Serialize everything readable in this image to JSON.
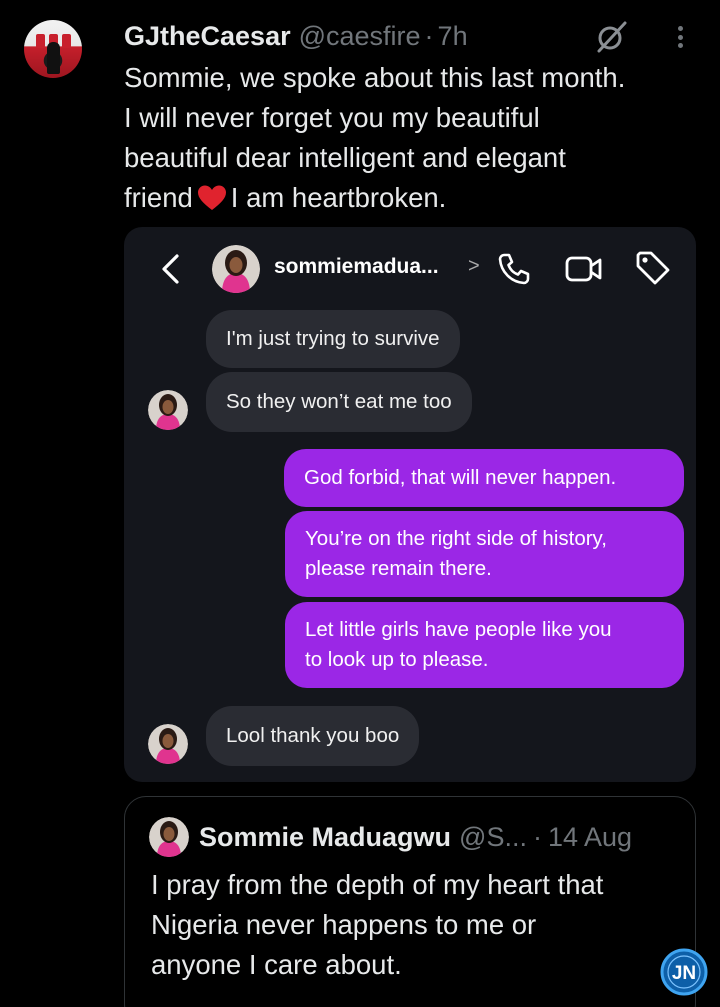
{
  "tweet": {
    "name": "GJtheCaesar",
    "handle": "@caesfire",
    "separator": "·",
    "time": "7h",
    "text_lines": [
      "Sommie, we spoke about this last month.",
      "I will never forget you my beautiful",
      "beautiful dear intelligent and  elegant",
      "friend",
      "I am heartbroken."
    ],
    "emoji": "red-heart"
  },
  "dm_screenshot": {
    "contact_name": "sommiemadua...",
    "chevron": ">",
    "messages": [
      {
        "side": "in",
        "text": "I'm just trying to survive"
      },
      {
        "side": "in",
        "text": "So they won’t eat me too"
      },
      {
        "side": "out",
        "text": "God forbid, that will never happen."
      },
      {
        "side": "out",
        "lines": [
          "You’re on the right side of history,",
          "please remain there."
        ]
      },
      {
        "side": "out",
        "lines": [
          "Let little girls have people like you",
          "to look up to please."
        ]
      },
      {
        "side": "in",
        "text": "Lool thank you boo"
      }
    ],
    "colors": {
      "outgoing": "#9b27e6",
      "incoming": "#2a2c33",
      "background": "#14161c"
    }
  },
  "quote": {
    "name": "Sommie Maduagwu",
    "handle": "@S...",
    "separator": "·",
    "time": "14 Aug",
    "text_lines": [
      "I pray from the depth of my heart that",
      "Nigeria never happens to me or",
      "anyone I care about."
    ]
  },
  "watermark": "JN"
}
